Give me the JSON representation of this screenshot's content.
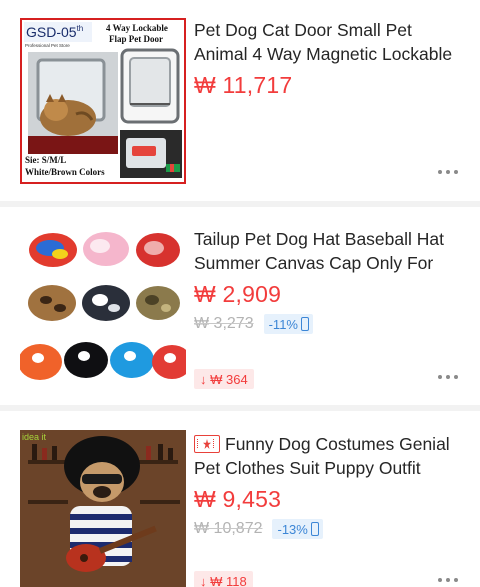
{
  "products": [
    {
      "title": "Pet Dog Cat Door Small Pet Animal 4 Way Magnetic Lockable",
      "price": "₩ 11,717",
      "image": {
        "code": "GSD-05",
        "code_sup": "th",
        "store": "Professional Pet Store",
        "headline": "4 Way Lockable Flap Pet Door",
        "size_line": "Sie: S/M/L",
        "color_line": "White/Brown Colors"
      }
    },
    {
      "title": "Tailup Pet Dog Hat Baseball Hat Summer Canvas Cap Only For",
      "price": "₩ 2,909",
      "old_price": "₩ 3,273",
      "discount": "-11%",
      "price_drop": "↓ ₩ 364"
    },
    {
      "title": "Funny Dog Costumes Genial Pet Clothes Suit Puppy Outfit",
      "price": "₩ 9,453",
      "old_price": "₩ 10,872",
      "discount": "-13%",
      "price_drop": "↓ ₩ 118",
      "image": {
        "watermark": "idea  it"
      }
    }
  ],
  "icons": {
    "more": "more-dots-icon",
    "discount_mobile": "mobile-phone-icon",
    "video": "video-play-icon"
  },
  "colors": {
    "price": "#f23c3c",
    "discount_text": "#3c86d6",
    "discount_bg": "#e6f1fc",
    "drop_bg": "#fde8e8"
  }
}
